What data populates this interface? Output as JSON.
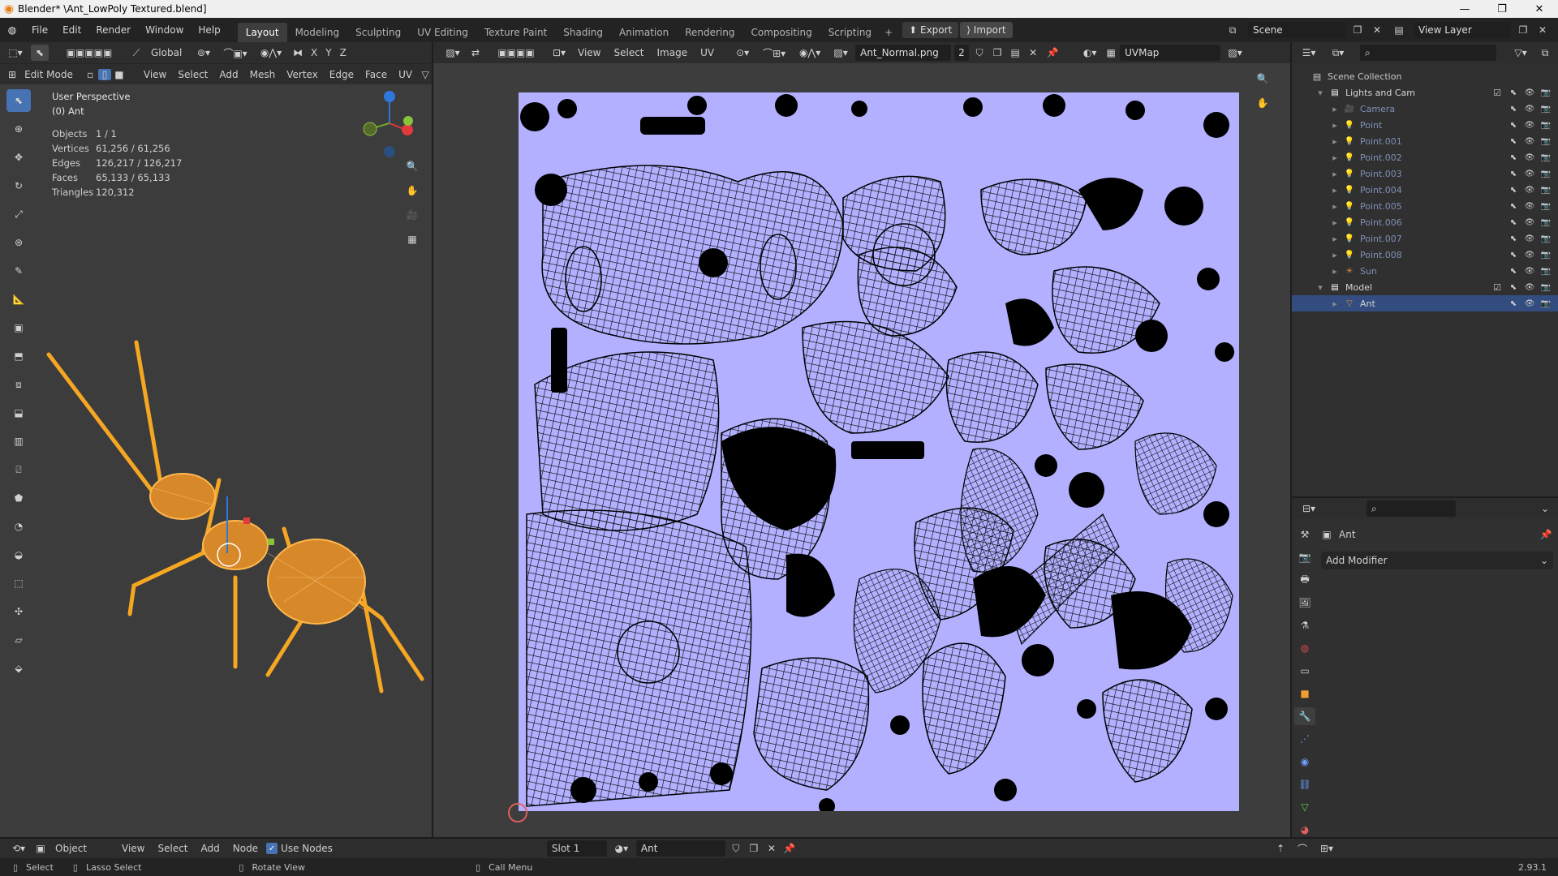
{
  "window": {
    "title": "Blender*  \\Ant_LowPoly Textured.blend]"
  },
  "menu": [
    "File",
    "Edit",
    "Render",
    "Window",
    "Help"
  ],
  "workspaces": [
    "Layout",
    "Modeling",
    "Sculpting",
    "UV Editing",
    "Texture Paint",
    "Shading",
    "Animation",
    "Rendering",
    "Compositing",
    "Scripting"
  ],
  "topbar": {
    "export_label": "Export",
    "import_label": "Import",
    "scene": "Scene",
    "view_layer": "View Layer"
  },
  "viewport": {
    "mode": "Edit Mode",
    "orientation": "Global",
    "menus": [
      "View",
      "Select",
      "Add",
      "Mesh",
      "Vertex",
      "Edge",
      "Face",
      "UV"
    ],
    "axis_x": "X",
    "axis_y": "Y",
    "axis_z": "Z",
    "overlay_title": "User Perspective",
    "overlay_object": "(0) Ant",
    "stats": [
      {
        "label": "Objects",
        "value": "1 / 1"
      },
      {
        "label": "Vertices",
        "value": "61,256 / 61,256"
      },
      {
        "label": "Edges",
        "value": "126,217 / 126,217"
      },
      {
        "label": "Faces",
        "value": "65,133 / 65,133"
      },
      {
        "label": "Triangles",
        "value": "120,312"
      }
    ]
  },
  "uv_editor": {
    "menus": [
      "View",
      "Select",
      "Image",
      "UV"
    ],
    "image_name": "Ant_Normal.png",
    "users": "2",
    "uvmap": "UVMap",
    "canvas_color": "#b3b1ff"
  },
  "outliner": {
    "search_placeholder": "",
    "root": "Scene Collection",
    "rows": [
      {
        "name": "Lights and Cam",
        "indent": 1,
        "type": "collection"
      },
      {
        "name": "Camera",
        "indent": 2,
        "type": "camera"
      },
      {
        "name": "Point",
        "indent": 2,
        "type": "light"
      },
      {
        "name": "Point.001",
        "indent": 2,
        "type": "light"
      },
      {
        "name": "Point.002",
        "indent": 2,
        "type": "light"
      },
      {
        "name": "Point.003",
        "indent": 2,
        "type": "light"
      },
      {
        "name": "Point.004",
        "indent": 2,
        "type": "light"
      },
      {
        "name": "Point.005",
        "indent": 2,
        "type": "light"
      },
      {
        "name": "Point.006",
        "indent": 2,
        "type": "light"
      },
      {
        "name": "Point.007",
        "indent": 2,
        "type": "light"
      },
      {
        "name": "Point.008",
        "indent": 2,
        "type": "light"
      },
      {
        "name": "Sun",
        "indent": 2,
        "type": "sun"
      },
      {
        "name": "Model",
        "indent": 1,
        "type": "collection"
      },
      {
        "name": "Ant",
        "indent": 2,
        "type": "mesh",
        "selected": true
      }
    ]
  },
  "properties": {
    "object_name": "Ant",
    "add_modifier": "Add Modifier"
  },
  "node_header": {
    "object_dropdown": "Object",
    "menus": [
      "View",
      "Select",
      "Add",
      "Node"
    ],
    "use_nodes": "Use Nodes",
    "slot": "Slot 1",
    "material": "Ant"
  },
  "statusbar": {
    "select": "Select",
    "lasso": "Lasso Select",
    "rotate": "Rotate View",
    "call_menu": "Call Menu",
    "version": "2.93.1"
  },
  "colors": {
    "accent": "#4772b3",
    "mesh": "#f5a623",
    "uv_bg": "#b3b1ff"
  }
}
